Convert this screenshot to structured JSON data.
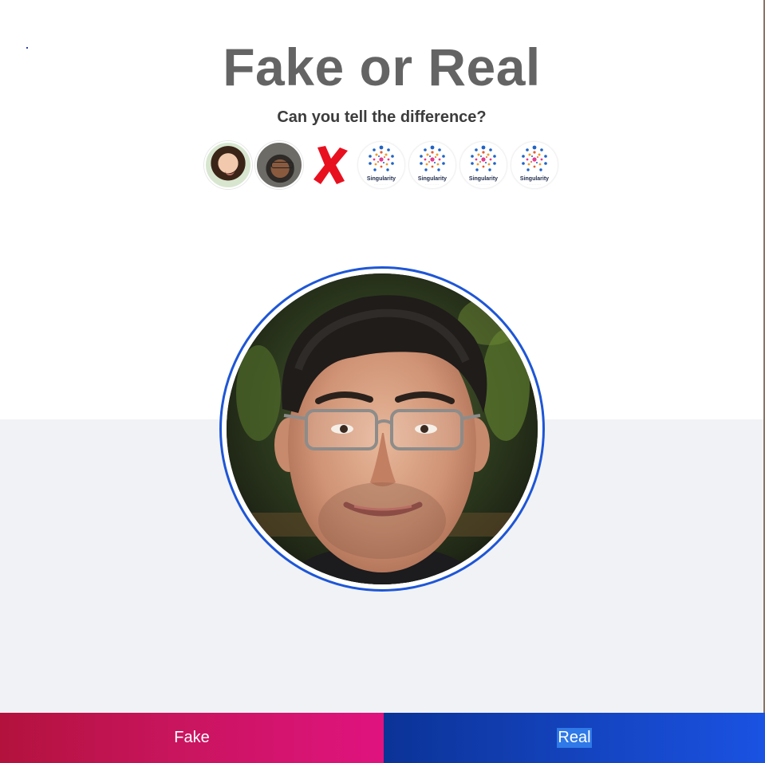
{
  "header": {
    "title": "Fake or Real",
    "subtitle": "Can you tell the difference?"
  },
  "history": {
    "items": [
      {
        "type": "photo",
        "icon": "girl-face-thumbnail-icon"
      },
      {
        "type": "photo",
        "icon": "man-face-thumbnail-icon"
      },
      {
        "type": "cross",
        "icon": "wrong-cross-icon",
        "color": "#e8101f"
      },
      {
        "type": "logo",
        "icon": "singularity-logo-icon",
        "label": "Singularity"
      },
      {
        "type": "logo",
        "icon": "singularity-logo-icon",
        "label": "Singularity"
      },
      {
        "type": "logo",
        "icon": "singularity-logo-icon",
        "label": "Singularity"
      },
      {
        "type": "logo",
        "icon": "singularity-logo-icon",
        "label": "Singularity"
      }
    ]
  },
  "portrait": {
    "icon": "face-portrait-image",
    "ring_color": "#1e56d6"
  },
  "actions": {
    "fake_label": "Fake",
    "real_label": "Real",
    "fake_color": "#c8155d",
    "real_color": "#1341b9"
  }
}
